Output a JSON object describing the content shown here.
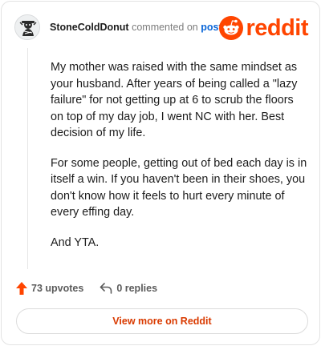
{
  "comment": {
    "username": "StoneColdDonut",
    "action_text": "commented on",
    "target_link": "post",
    "paragraphs": [
      "My mother was raised with the same mindset as your husband. After years of being called a \"lazy failure\" for not getting up at 6 to scrub the floors on top of my day job, I went NC with her. Best decision of my life.",
      "For some people, getting out of bed each day is in itself a win. If you haven't been in their shoes, you don't know how it feels to hurt every minute of every effing day.",
      "And YTA."
    ]
  },
  "brand": {
    "wordmark": "reddit",
    "color": "#ff4500"
  },
  "actions": {
    "upvotes": "73 upvotes",
    "replies": "0 replies",
    "upvote_icon_color": "#ff4500"
  },
  "footer": {
    "view_more_label": "View more on Reddit",
    "view_more_color": "#d93a00"
  }
}
